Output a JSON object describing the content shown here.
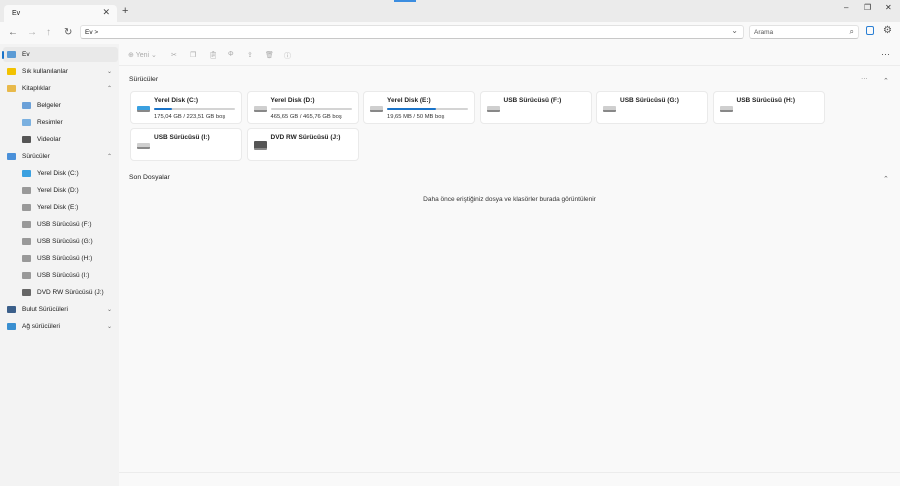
{
  "tab": {
    "title": "Ev",
    "close": "✕",
    "new": "+"
  },
  "window": {
    "minimize": "–",
    "restore": "❐",
    "close": "✕"
  },
  "address": {
    "path": "Ev >",
    "dropdown": "⌄",
    "search_placeholder": "Arama"
  },
  "toolbar": {
    "new_label": "Yeni",
    "more": "···"
  },
  "sidebar": {
    "items": [
      {
        "label": "Ev",
        "icon": "home-icon",
        "color": "#5b9bd5",
        "indent": 0,
        "sel": true
      },
      {
        "label": "Sık kullanılanlar",
        "icon": "star-icon",
        "color": "#f2c200",
        "indent": 0,
        "exp": "⌄"
      },
      {
        "label": "Kitaplıklar",
        "icon": "library-icon",
        "color": "#e8b94a",
        "indent": 0,
        "exp": "⌃"
      },
      {
        "label": "Belgeler",
        "icon": "documents-icon",
        "color": "#6aa0d8",
        "indent": 1
      },
      {
        "label": "Resimler",
        "icon": "pictures-icon",
        "color": "#7ab0e0",
        "indent": 1
      },
      {
        "label": "Videolar",
        "icon": "videos-icon",
        "color": "#555",
        "indent": 1
      },
      {
        "label": "Sürücüler",
        "icon": "drives-icon",
        "color": "#4a90d9",
        "indent": 0,
        "exp": "⌃"
      },
      {
        "label": "Yerel Disk (C:)",
        "icon": "windows-drive-icon",
        "color": "#3aa0e0",
        "indent": 1
      },
      {
        "label": "Yerel Disk (D:)",
        "icon": "drive-icon",
        "color": "#999",
        "indent": 1
      },
      {
        "label": "Yerel Disk (E:)",
        "icon": "drive-icon",
        "color": "#999",
        "indent": 1
      },
      {
        "label": "USB Sürücüsü (F:)",
        "icon": "usb-drive-icon",
        "color": "#999",
        "indent": 1
      },
      {
        "label": "USB Sürücüsü (G:)",
        "icon": "usb-drive-icon",
        "color": "#999",
        "indent": 1
      },
      {
        "label": "USB Sürücüsü (H:)",
        "icon": "usb-drive-icon",
        "color": "#999",
        "indent": 1
      },
      {
        "label": "USB Sürücüsü (I:)",
        "icon": "usb-drive-icon",
        "color": "#999",
        "indent": 1
      },
      {
        "label": "DVD RW Sürücüsü (J:)",
        "icon": "dvd-drive-icon",
        "color": "#666",
        "indent": 1
      },
      {
        "label": "Bulut Sürücüleri",
        "icon": "cloud-icon",
        "color": "#3b5f8a",
        "indent": 0,
        "exp": "⌄"
      },
      {
        "label": "Ağ sürücüleri",
        "icon": "network-icon",
        "color": "#3a8fd0",
        "indent": 0,
        "exp": "⌄"
      }
    ]
  },
  "drives_section": {
    "title": "Sürücüler",
    "more": "···",
    "collapse": "⌃",
    "drives": [
      {
        "name": "Yerel Disk (C:)",
        "free": "175,04 GB / 223,51 GB boş",
        "used": 0.22,
        "win": true
      },
      {
        "name": "Yerel Disk (D:)",
        "free": "465,65 GB / 465,76 GB boş",
        "used": 0.0
      },
      {
        "name": "Yerel Disk (E:)",
        "free": "19,65 MB / 50 MB boş",
        "used": 0.61
      },
      {
        "name": "USB Sürücüsü (F:)"
      },
      {
        "name": "USB Sürücüsü (G:)"
      },
      {
        "name": "USB Sürücüsü (H:)"
      },
      {
        "name": "USB Sürücüsü (I:)"
      },
      {
        "name": "DVD RW Sürücüsü (J:)",
        "dvd": true
      }
    ]
  },
  "recent_section": {
    "title": "Son Dosyalar",
    "collapse": "⌃",
    "empty_text": "Daha önce eriştiğiniz dosya ve klasörler burada görüntülenir"
  },
  "colors": {
    "accent": "#1a73c8"
  }
}
